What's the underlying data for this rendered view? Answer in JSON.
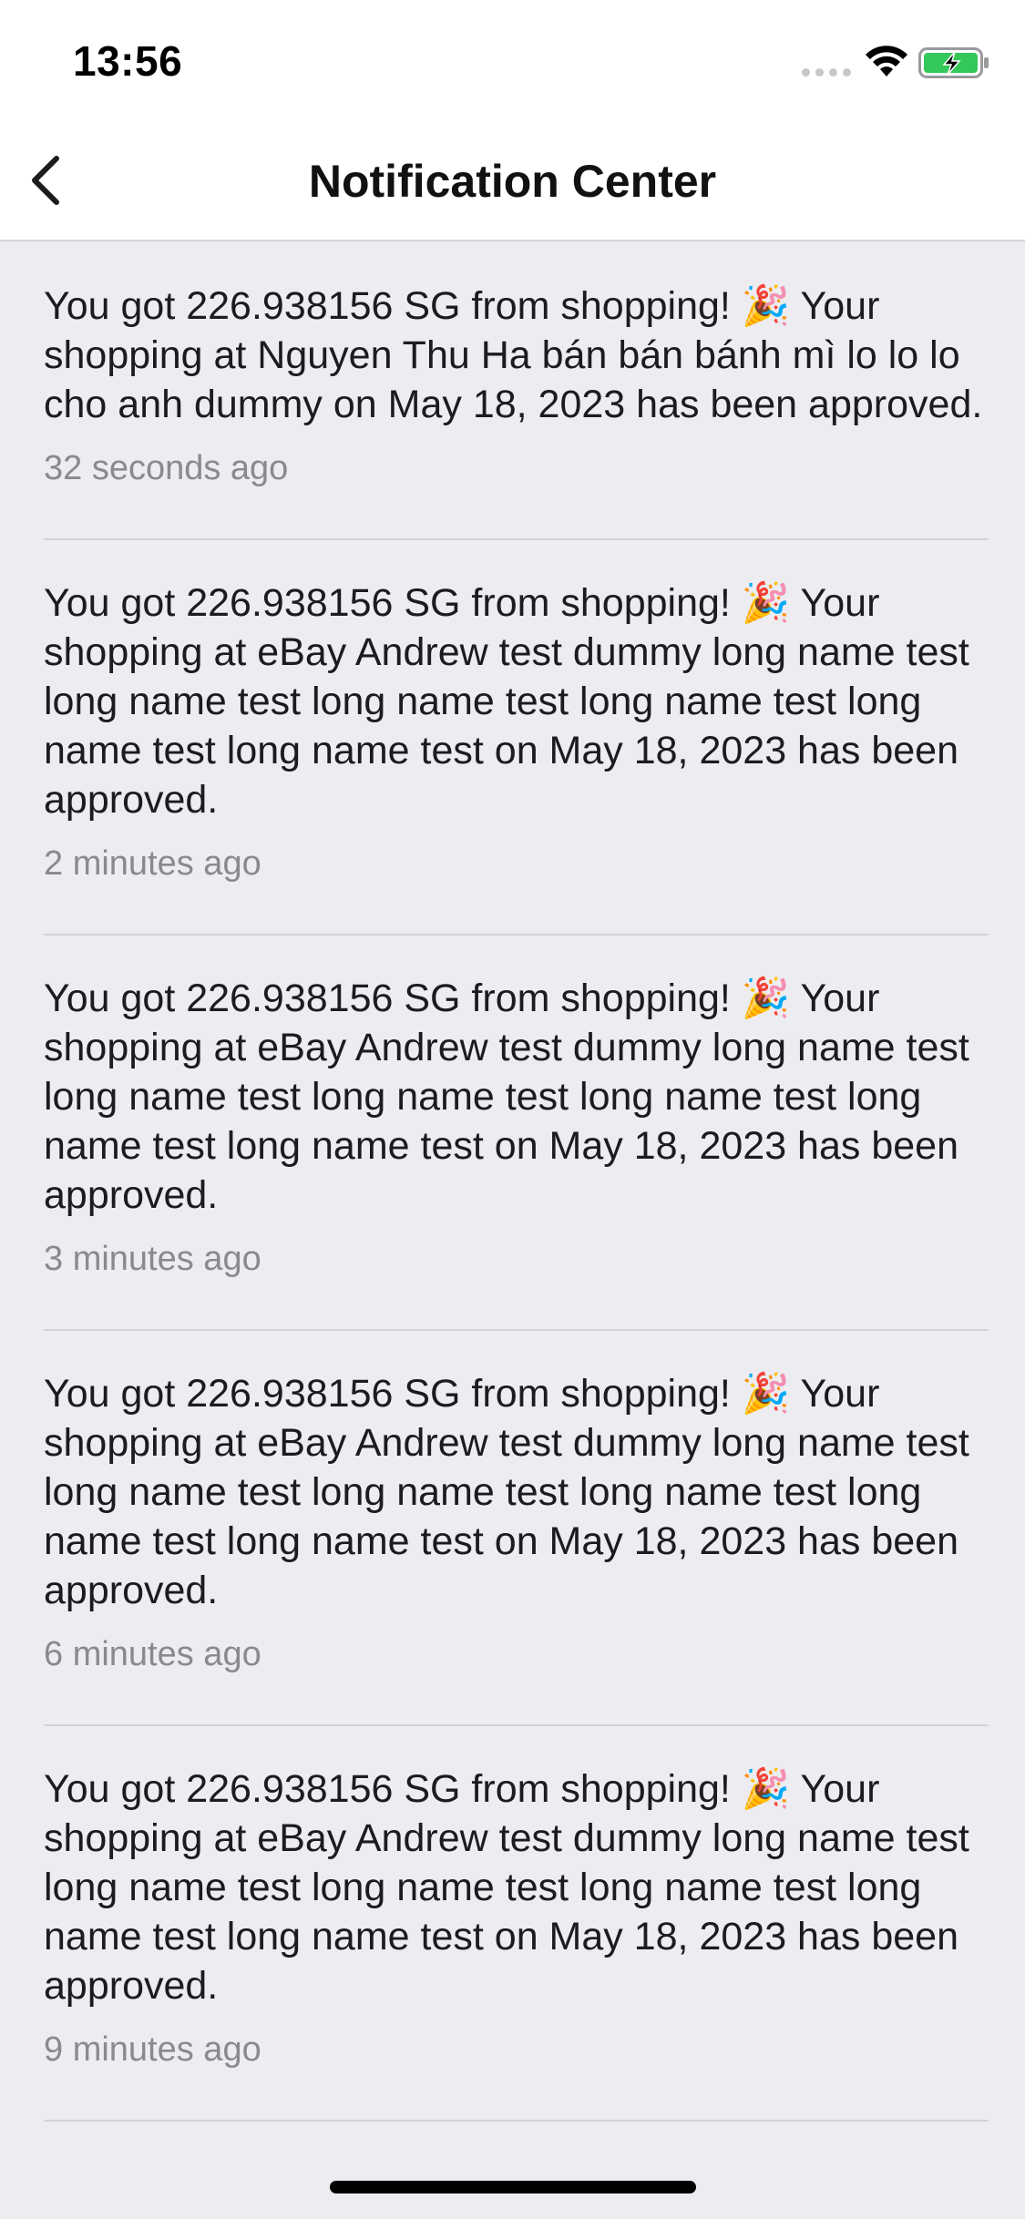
{
  "status_bar": {
    "time": "13:56",
    "battery_color": "#34c759"
  },
  "nav": {
    "title": "Notification Center",
    "back_icon": "chevron-left-icon"
  },
  "notifications": [
    {
      "message": "You got 226.938156 SG from shopping! 🎉 Your shopping at Nguyen Thu Ha bán bán bánh mì lo lo lo cho anh dummy on May 18, 2023 has been approved.",
      "time": "32 seconds ago"
    },
    {
      "message": "You got 226.938156 SG from shopping! 🎉 Your shopping at eBay Andrew test dummy long name test long name test long name test long name test long name test long name test on May 18, 2023 has been approved.",
      "time": "2 minutes ago"
    },
    {
      "message": "You got 226.938156 SG from shopping! 🎉 Your shopping at eBay Andrew test dummy long name test long name test long name test long name test long name test long name test on May 18, 2023 has been approved.",
      "time": "3 minutes ago"
    },
    {
      "message": "You got 226.938156 SG from shopping! 🎉 Your shopping at eBay Andrew test dummy long name test long name test long name test long name test long name test long name test on May 18, 2023 has been approved.",
      "time": "6 minutes ago"
    },
    {
      "message": "You got 226.938156 SG from shopping! 🎉 Your shopping at eBay Andrew test dummy long name test long name test long name test long name test long name test long name test on May 18, 2023 has been approved.",
      "time": "9 minutes ago"
    }
  ]
}
